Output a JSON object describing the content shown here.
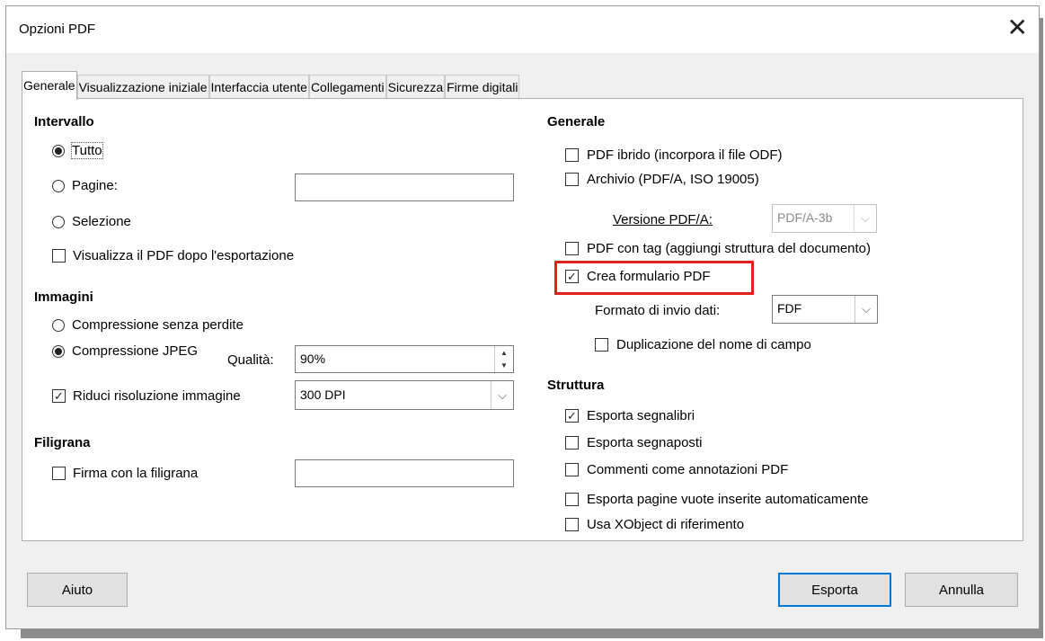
{
  "window": {
    "title": "Opzioni PDF",
    "close_glyph": "✕"
  },
  "tabs": [
    {
      "label": "Generale",
      "active": true
    },
    {
      "label": "Visualizzazione iniziale"
    },
    {
      "label": "Interfaccia utente"
    },
    {
      "label": "Collegamenti"
    },
    {
      "label": "Sicurezza"
    },
    {
      "label": "Firme digitali"
    }
  ],
  "intervallo": {
    "heading": "Intervallo",
    "tutto": "Tutto",
    "pagine": "Pagine:",
    "pagine_value": "",
    "selezione": "Selezione",
    "visualizza": "Visualizza il PDF dopo l'esportazione"
  },
  "immagini": {
    "heading": "Immagini",
    "senza_perdite": "Compressione senza perdite",
    "jpeg": "Compressione JPEG",
    "qualita_label": "Qualità:",
    "qualita_value": "90%",
    "riduci": "Riduci risoluzione immagine",
    "risoluzione_value": "300 DPI"
  },
  "filigrana": {
    "heading": "Filigrana",
    "firma": "Firma con la filigrana",
    "firma_value": ""
  },
  "generale": {
    "heading": "Generale",
    "ibrido": "PDF ibrido (incorpora il file ODF)",
    "archivio": "Archivio (PDF/A, ISO 19005)",
    "versione_label": "Versione PDF/A:",
    "versione_value": "PDF/A-3b",
    "tag": "PDF con tag (aggiungi struttura del documento)",
    "formulario": "Crea formulario PDF",
    "formato_label": "Formato di invio dati:",
    "formato_value": "FDF",
    "duplicazione": "Duplicazione del nome di campo"
  },
  "struttura": {
    "heading": "Struttura",
    "segnalibri": "Esporta segnalibri",
    "segnaposti": "Esporta segnaposti",
    "commenti": "Commenti come annotazioni PDF",
    "pagine_vuote": "Esporta pagine vuote inserite automaticamente",
    "xobject": "Usa XObject di riferimento"
  },
  "buttons": {
    "aiuto": "Aiuto",
    "esporta": "Esporta",
    "annulla": "Annulla"
  },
  "glyphs": {
    "check": "✓",
    "chevron": "⌵",
    "spin_up": "▲",
    "spin_down": "▼"
  },
  "colors": {
    "highlight": "#e3211c",
    "default_button": "#0078d7"
  }
}
